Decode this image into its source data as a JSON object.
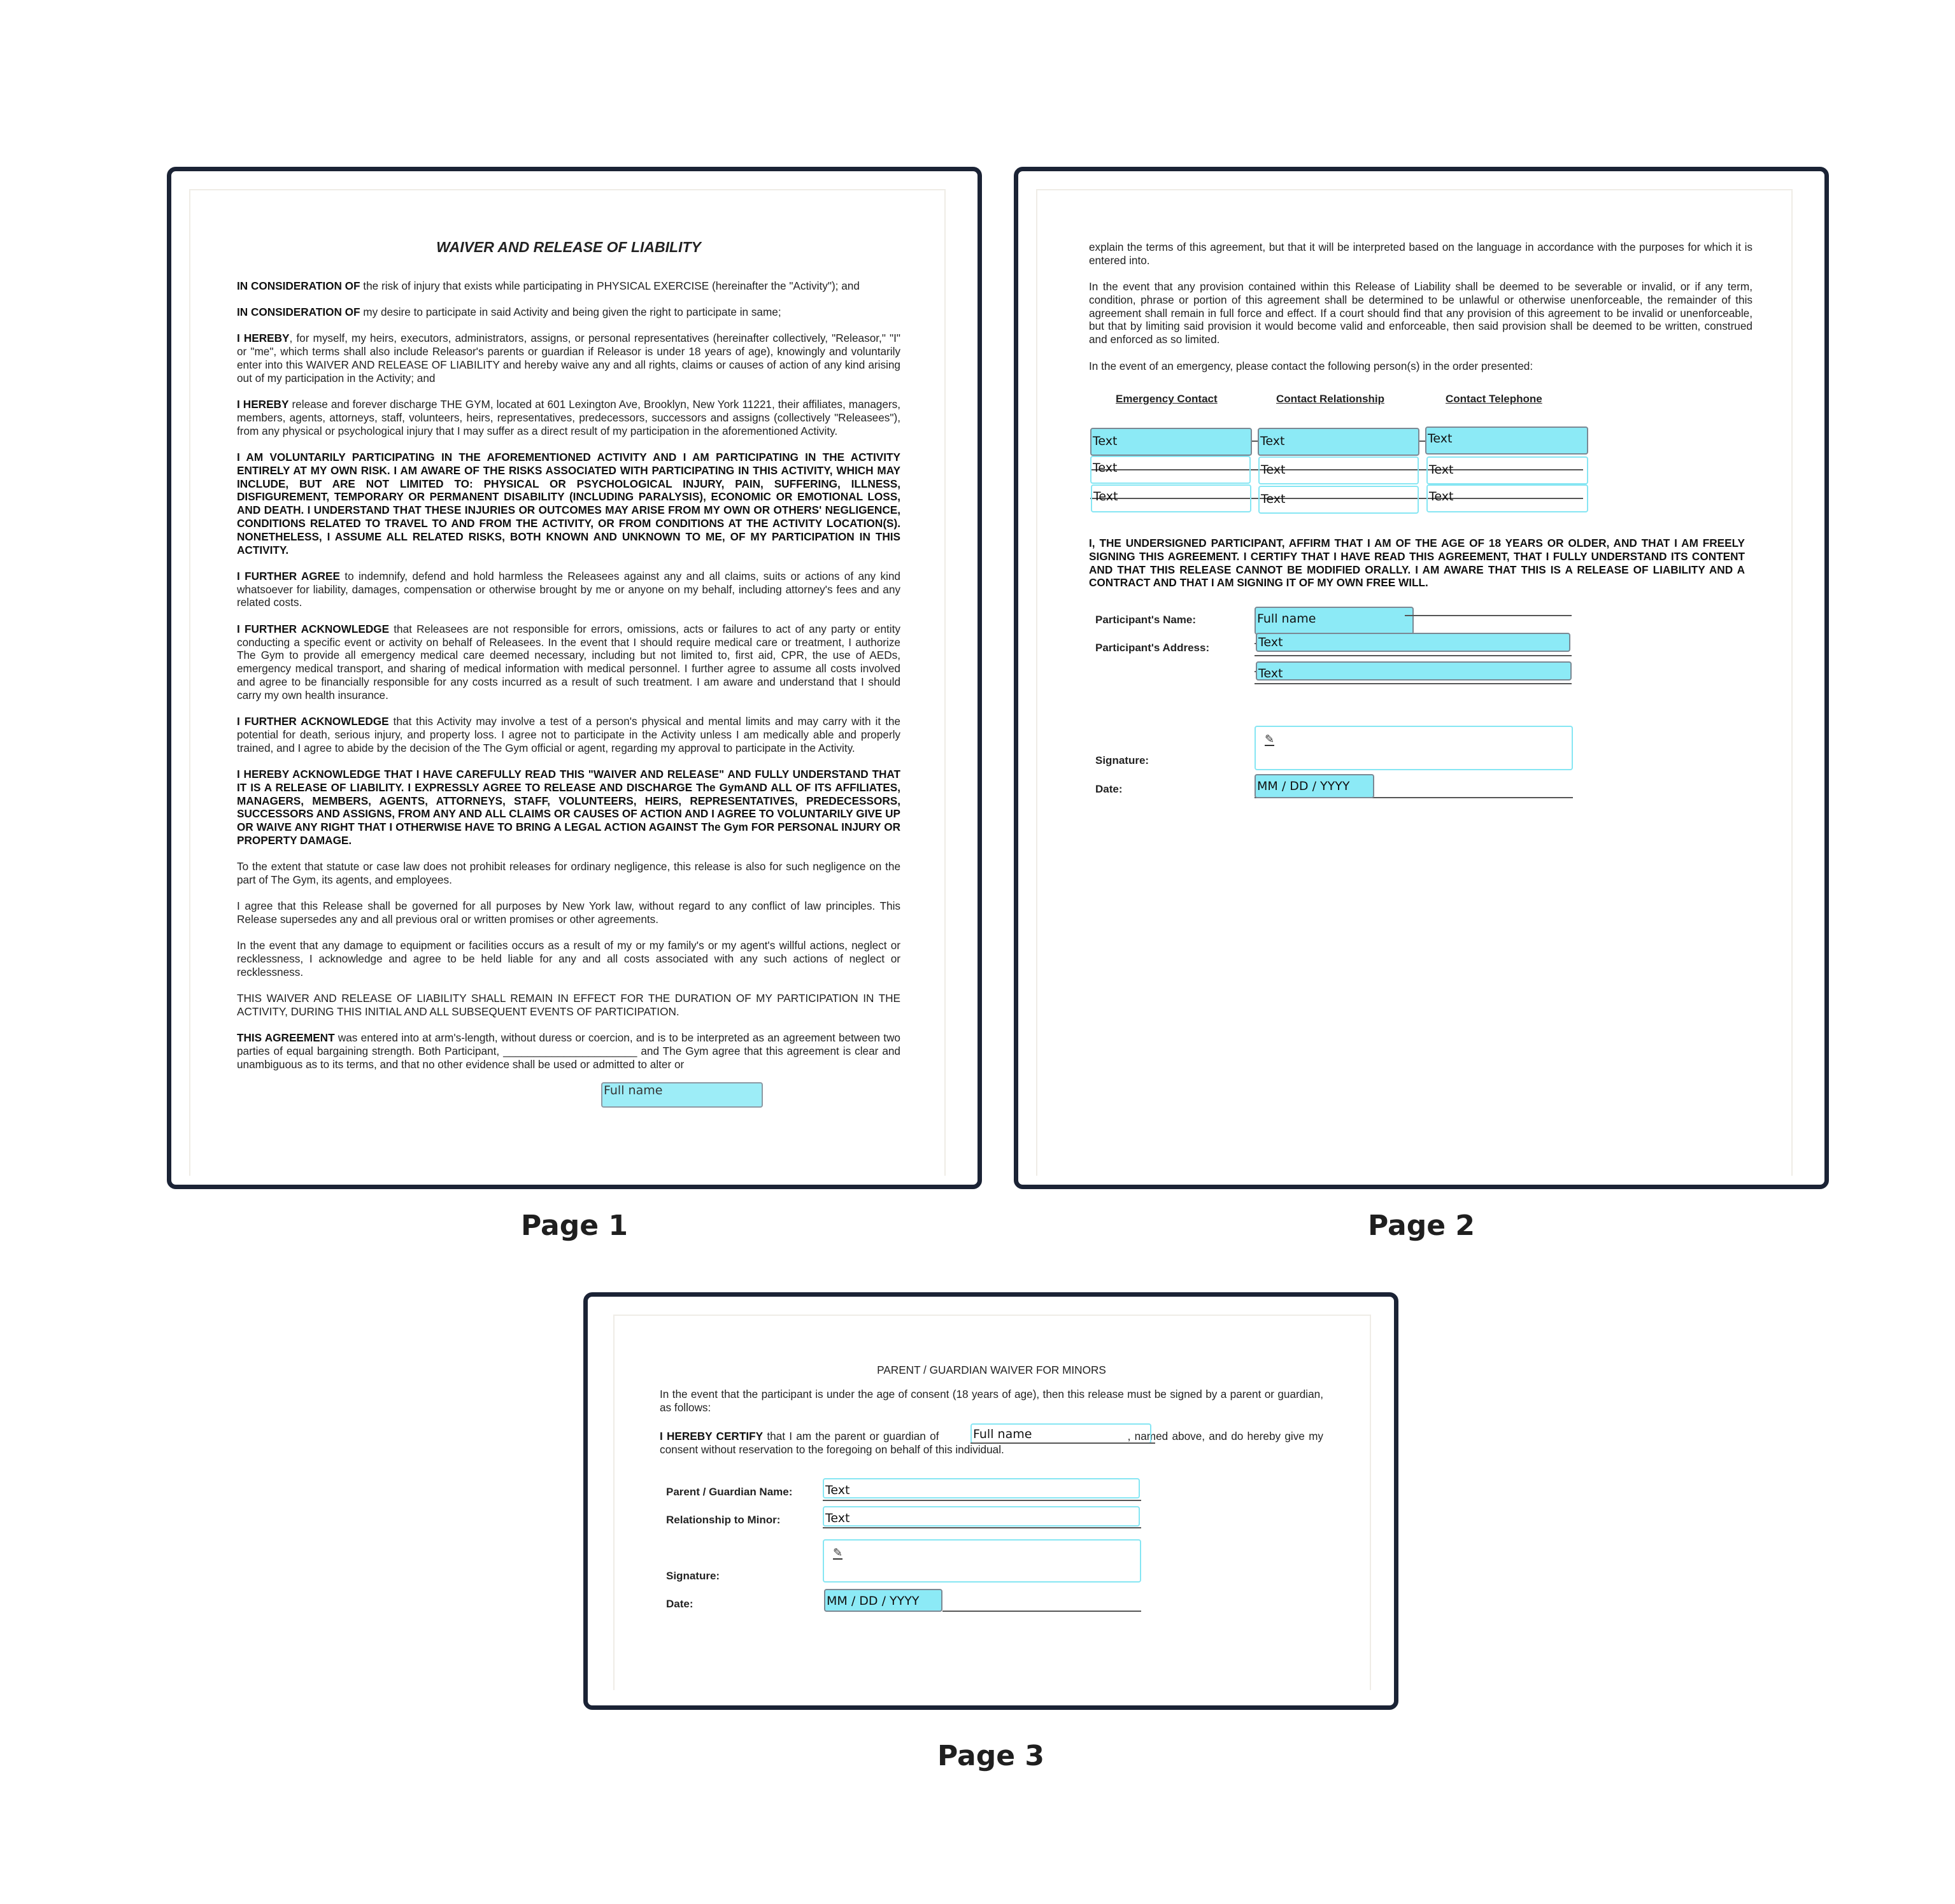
{
  "pages": [
    {
      "label": "Page 1",
      "title": "WAIVER AND RELEASE OF LIABILITY",
      "paragraphs": [
        {
          "lead": "IN CONSIDERATION OF",
          "text": " the risk of injury that exists while participating in PHYSICAL EXERCISE (hereinafter the \"Activity\"); and"
        },
        {
          "lead": "IN CONSIDERATION OF",
          "text": " my desire to participate in said Activity and being given the right to participate in same;"
        },
        {
          "lead": "I HEREBY",
          "text": ", for myself, my heirs, executors, administrators, assigns, or personal representatives (hereinafter collectively, \"Releasor,\" \"I\" or \"me\", which terms shall also include Releasor's parents or guardian if Releasor is under 18 years of age), knowingly and voluntarily enter into this WAIVER AND RELEASE OF LIABILITY and hereby waive any and all rights, claims or causes of action of any kind arising out of my participation in the Activity; and"
        },
        {
          "lead": "I HEREBY",
          "text": " release and forever discharge THE GYM, located at 601 Lexington Ave, Brooklyn, New York 11221, their affiliates, managers, members, agents, attorneys, staff, volunteers, heirs, representatives, predecessors, successors and assigns (collectively \"Releasees\"), from any physical or psychological injury that I may suffer as a direct result of my participation in the aforementioned Activity."
        },
        {
          "lead": "",
          "caps": "I AM VOLUNTARILY PARTICIPATING IN THE AFOREMENTIONED ACTIVITY AND I AM PARTICIPATING IN THE ACTIVITY ENTIRELY AT MY OWN RISK. I AM AWARE OF THE RISKS ASSOCIATED WITH PARTICIPATING IN THIS ACTIVITY, WHICH MAY INCLUDE, BUT ARE NOT LIMITED TO: PHYSICAL OR PSYCHOLOGICAL INJURY, PAIN, SUFFERING, ILLNESS, DISFIGUREMENT, TEMPORARY OR PERMANENT DISABILITY (INCLUDING PARALYSIS), ECONOMIC OR EMOTIONAL LOSS, AND DEATH. I UNDERSTAND THAT THESE INJURIES OR OUTCOMES MAY ARISE FROM MY OWN OR OTHERS' NEGLIGENCE, CONDITIONS RELATED TO TRAVEL TO AND FROM THE ACTIVITY, OR FROM CONDITIONS AT THE ACTIVITY LOCATION(S). NONETHELESS, I ASSUME ALL RELATED RISKS, BOTH KNOWN AND UNKNOWN TO ME, OF MY PARTICIPATION IN THIS ACTIVITY."
        },
        {
          "lead": "I FURTHER AGREE",
          "text": " to indemnify, defend and hold harmless the Releasees against any and all claims, suits or actions of any kind whatsoever for liability, damages, compensation or otherwise brought by me or anyone on my behalf, including attorney's fees and any related costs."
        },
        {
          "lead": "I FURTHER ACKNOWLEDGE",
          "text": " that Releasees are not responsible for errors, omissions, acts or failures to act of any party or entity conducting a specific event or activity on behalf of Releasees. In the event that I should require medical care or treatment, I authorize The Gym to provide all emergency medical care deemed necessary, including but not limited to, first aid, CPR, the use of AEDs, emergency medical transport, and sharing of medical information with medical personnel. I further agree to assume all costs involved and agree to be financially responsible for any costs incurred as a result of such treatment. I am aware and understand that I should carry my own health insurance."
        },
        {
          "lead": "I FURTHER ACKNOWLEDGE",
          "text": " that this Activity may involve a test of a person's physical and mental limits and may carry with it the potential for death, serious injury, and property loss. I agree not to participate in the Activity unless I am medically able and properly trained, and I agree to abide by the decision of the The Gym official or agent, regarding my approval to participate in the Activity."
        },
        {
          "lead": "",
          "caps": "I HEREBY ACKNOWLEDGE THAT I HAVE CAREFULLY READ THIS \"WAIVER AND RELEASE\" AND FULLY UNDERSTAND THAT IT IS A RELEASE OF LIABILITY. I EXPRESSLY AGREE TO RELEASE AND DISCHARGE The GymAND ALL OF ITS AFFILIATES, MANAGERS, MEMBERS, AGENTS, ATTORNEYS, STAFF, VOLUNTEERS, HEIRS, REPRESENTATIVES, PREDECESSORS, SUCCESSORS AND ASSIGNS, FROM ANY AND ALL CLAIMS OR CAUSES OF ACTION AND I AGREE TO VOLUNTARILY GIVE UP OR WAIVE ANY RIGHT THAT I OTHERWISE HAVE TO BRING A LEGAL ACTION AGAINST The Gym FOR PERSONAL INJURY OR PROPERTY DAMAGE."
        },
        {
          "lead": "",
          "text": "To the extent that statute or case law does not prohibit releases for ordinary negligence, this release is also for such negligence on the part of The Gym, its agents, and employees."
        },
        {
          "lead": "",
          "text": "I agree that this Release shall be governed for all purposes by New York law, without regard to any conflict of law principles. This Release supersedes any and all previous oral or written promises or other agreements."
        },
        {
          "lead": "",
          "text": "In the event that any damage to equipment or facilities occurs as a result of my or my family's or my agent's willful actions, neglect or recklessness, I acknowledge and agree to be held liable for any and all costs associated with any such actions of neglect or recklessness."
        },
        {
          "lead": "",
          "text": "THIS WAIVER AND RELEASE OF LIABILITY SHALL REMAIN IN EFFECT FOR THE DURATION OF MY PARTICIPATION IN THE ACTIVITY, DURING THIS INITIAL AND ALL SUBSEQUENT EVENTS OF PARTICIPATION."
        },
        {
          "lead": "THIS AGREEMENT",
          "text": " was entered into at arm's-length, without duress or coercion, and is to be interpreted as an agreement between two parties of equal bargaining strength. Both Participant, ______________________ and The Gym agree that this agreement is clear and unambiguous as to its terms, and that no other evidence shall be used or admitted to alter or"
        }
      ],
      "participant_field": {
        "value": "Full name"
      }
    },
    {
      "label": "Page 2",
      "paragraphs": [
        "explain the terms of this agreement, but that it will be interpreted based on the language in accordance with the purposes for which it is entered into.",
        "In the event that any provision contained within this Release of Liability shall be deemed to be severable or invalid, or if any term, condition, phrase or portion of this agreement shall be determined to be unlawful or otherwise unenforceable, the remainder of this agreement shall remain in full force and effect. If a court should find that any provision of this agreement to be invalid or unenforceable, but that by limiting said provision it would become valid and enforceable, then said provision shall be deemed to be written, construed and enforced as so limited.",
        "In the event of an emergency, please contact the following person(s) in the order presented:"
      ],
      "contact_headers": [
        "Emergency Contact",
        "Contact Relationship",
        "Contact Telephone"
      ],
      "contact_rows": [
        [
          "Text",
          "Text",
          "Text"
        ],
        [
          "Text",
          "Text",
          "Text"
        ],
        [
          "Text",
          "Text",
          "Text"
        ]
      ],
      "affirmation": "I, THE UNDERSIGNED PARTICIPANT, AFFIRM THAT I AM OF THE AGE OF 18 YEARS OR OLDER, AND THAT I AM FREELY SIGNING THIS AGREEMENT. I CERTIFY THAT I HAVE READ THIS AGREEMENT, THAT I FULLY UNDERSTAND ITS CONTENT AND THAT THIS RELEASE CANNOT BE MODIFIED ORALLY. I AM AWARE THAT THIS IS A RELEASE OF LIABILITY AND A CONTRACT AND THAT I AM SIGNING IT OF MY OWN FREE WILL.",
      "labels": {
        "name": "Participant's Name:",
        "address": "Participant's Address:",
        "signature": "Signature:",
        "date": "Date:"
      },
      "fields": {
        "name": "Full name",
        "address1": "Text",
        "address2": "Text",
        "date": "MM / DD / YYYY"
      }
    },
    {
      "label": "Page 3",
      "title": "PARENT / GUARDIAN WAIVER FOR MINORS",
      "intro": "In the event that the participant is under the age of consent (18 years of age), then this release must be signed by a parent or guardian, as follows:",
      "certify_lead": "I HEREBY CERTIFY",
      "certify_before": " that I am the parent or guardian of ",
      "certify_after": ", named above, and do hereby give my consent without reservation to the foregoing on behalf of this individual.",
      "labels": {
        "guardian_name": "Parent / Guardian Name:",
        "relationship": "Relationship to Minor:",
        "signature": "Signature:",
        "date": "Date:"
      },
      "fields": {
        "minor_name": "Full name",
        "guardian_name": "Text",
        "relationship": "Text",
        "date": "MM / DD / YYYY"
      }
    }
  ],
  "icons": {
    "signature": "✎"
  },
  "colors": {
    "frame": "#1b2335",
    "field_fill": "#8ceaf6",
    "field_border": "#86e6f3"
  }
}
